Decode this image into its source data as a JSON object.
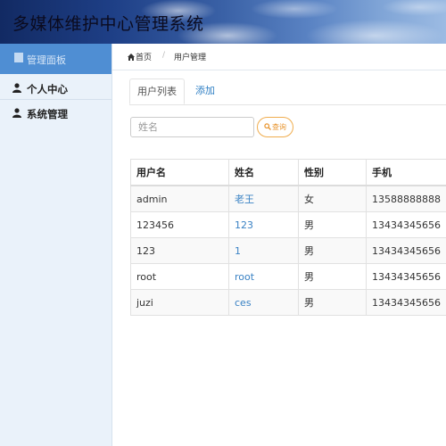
{
  "app": {
    "title": "多媒体维护中心管理系统"
  },
  "sidebar": {
    "active_label": "管理面板",
    "items": [
      {
        "label": "个人中心",
        "icon": "user-icon"
      },
      {
        "label": "系统管理",
        "icon": "user-icon"
      }
    ]
  },
  "breadcrumb": {
    "home": "首页",
    "separator": "/",
    "current": "用户管理"
  },
  "tabs": [
    {
      "label": "用户列表",
      "active": true
    },
    {
      "label": "添加",
      "active": false
    }
  ],
  "search": {
    "placeholder": "姓名",
    "button_label": "查询"
  },
  "table": {
    "headers": [
      "用户名",
      "姓名",
      "性别",
      "手机"
    ],
    "rows": [
      {
        "username": "admin",
        "name": "老王",
        "gender": "女",
        "phone": "13588888888"
      },
      {
        "username": "123456",
        "name": "123",
        "gender": "男",
        "phone": "13434345656"
      },
      {
        "username": "123",
        "name": "1",
        "gender": "男",
        "phone": "13434345656"
      },
      {
        "username": "root",
        "name": "root",
        "gender": "男",
        "phone": "13434345656"
      },
      {
        "username": "juzi",
        "name": "ces",
        "gender": "男",
        "phone": "13434345656"
      }
    ]
  },
  "colors": {
    "sidebar_active": "#4f8ed3",
    "sidebar_bg": "#eaf2fa",
    "link": "#3a82c4",
    "search_button": "#f0ad4e"
  }
}
